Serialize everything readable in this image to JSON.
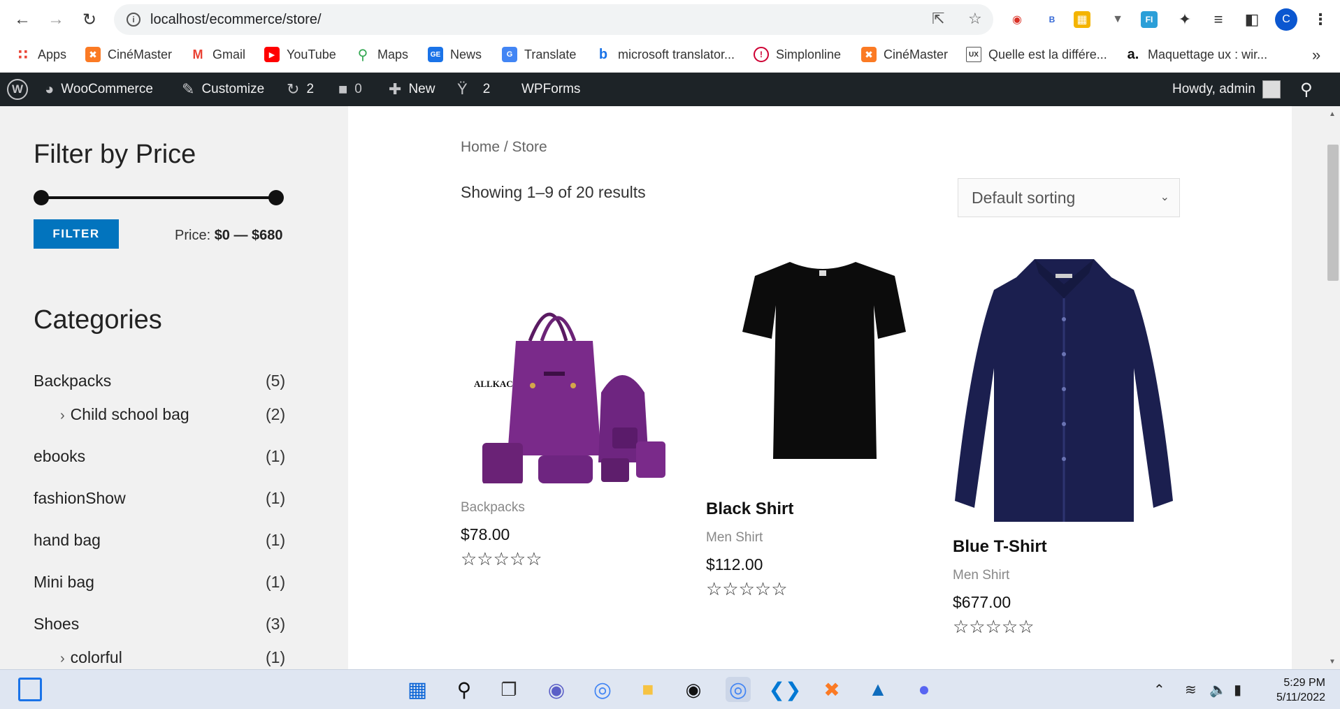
{
  "browser": {
    "url": "localhost/ecommerce/store/",
    "profile_initial": "C",
    "bookmarks": [
      {
        "label": "Apps",
        "icon": "apps-grid-icon",
        "color": "#ea4335"
      },
      {
        "label": "CinéMaster",
        "icon": "xampp-icon",
        "color": "#fb7a24"
      },
      {
        "label": "Gmail",
        "icon": "gmail-icon",
        "color": "#ea4335"
      },
      {
        "label": "YouTube",
        "icon": "youtube-icon",
        "color": "#ff0000"
      },
      {
        "label": "Maps",
        "icon": "maps-icon",
        "color": "#34a853"
      },
      {
        "label": "News",
        "icon": "news-icon",
        "color": "#1a73e8"
      },
      {
        "label": "Translate",
        "icon": "translate-icon",
        "color": "#4285f4"
      },
      {
        "label": "microsoft translator...",
        "icon": "bing-icon",
        "color": "#1a73e8"
      },
      {
        "label": "Simplonline",
        "icon": "simplonline-icon",
        "color": "#ce0033"
      },
      {
        "label": "CinéMaster",
        "icon": "xampp-icon",
        "color": "#fb7a24"
      },
      {
        "label": "Quelle est la différe...",
        "icon": "ux-icon",
        "color": "#555555"
      },
      {
        "label": "Maquettage ux : wir...",
        "icon": "amazon-icon",
        "color": "#111111"
      }
    ]
  },
  "adminbar": {
    "woocommerce": "WooCommerce",
    "customize": "Customize",
    "updates": "2",
    "comments": "0",
    "new": "New",
    "yoast": "2",
    "wpforms": "WPForms",
    "howdy": "Howdy, admin"
  },
  "sidebar": {
    "filter_title": "Filter by Price",
    "filter_button": "FILTER",
    "price_prefix": "Price:",
    "price_range": "$0 — $680",
    "categories_title": "Categories",
    "categories": [
      {
        "name": "Backpacks",
        "count": "(5)"
      },
      {
        "name": "Child school bag",
        "count": "(2)"
      },
      {
        "name": "ebooks",
        "count": "(1)"
      },
      {
        "name": "fashionShow",
        "count": "(1)"
      },
      {
        "name": "hand bag",
        "count": "(1)"
      },
      {
        "name": "Mini bag",
        "count": "(1)"
      },
      {
        "name": "Shoes",
        "count": "(3)"
      },
      {
        "name": "colorful",
        "count": "(1)"
      }
    ]
  },
  "main": {
    "breadcrumb": "Home / Store",
    "results": "Showing 1–9 of 20 results",
    "sorting": "Default sorting",
    "products": [
      {
        "title": "",
        "category": "Backpacks",
        "price": "$78.00",
        "rating": "☆☆☆☆☆",
        "brand_text": "ALLKACI"
      },
      {
        "title": "Black Shirt",
        "category": "Men Shirt",
        "price": "$112.00",
        "rating": "☆☆☆☆☆"
      },
      {
        "title": "Blue T-Shirt",
        "category": "Men Shirt",
        "price": "$677.00",
        "rating": "☆☆☆☆☆"
      }
    ]
  },
  "taskbar": {
    "time": "5:29 PM",
    "date": "5/11/2022"
  }
}
